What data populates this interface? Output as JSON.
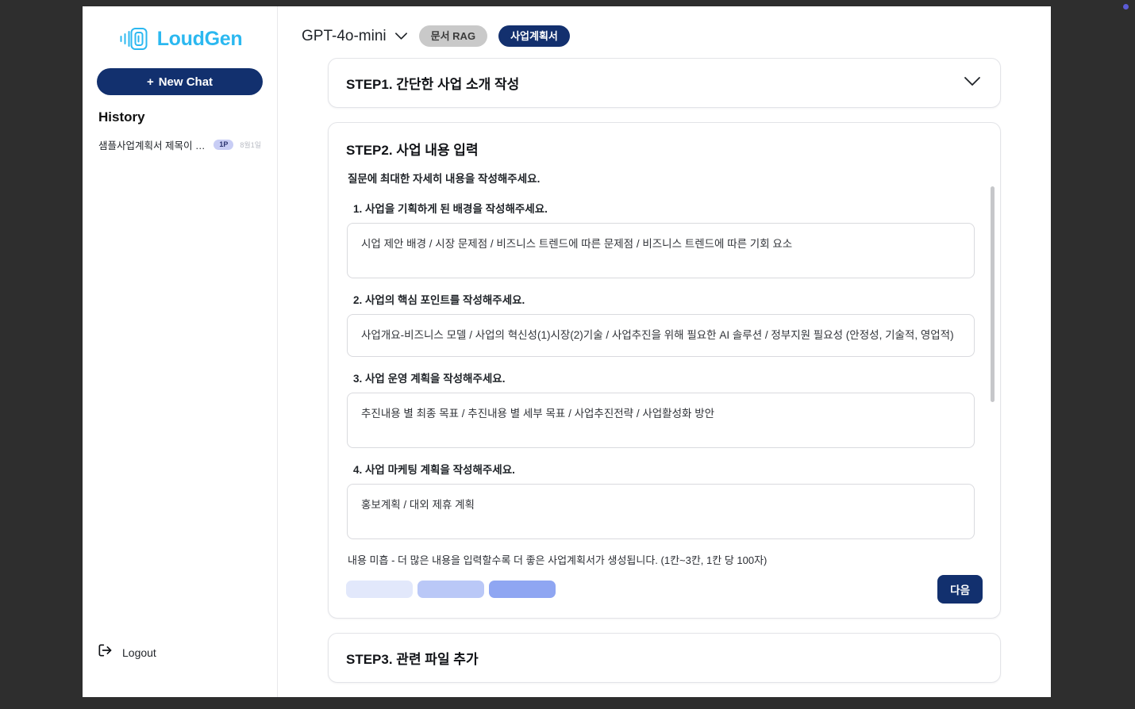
{
  "brand": {
    "name": "LoudGen",
    "icon": "soundwave-logo-icon",
    "color": "#2bb8f0"
  },
  "sidebar": {
    "new_chat_label": "New Chat",
    "new_chat_plus": "+",
    "history_heading": "History",
    "history_items": [
      {
        "label": "샘플사업계획서 제목이 나타...",
        "badge": "1P",
        "date": "8월1일"
      }
    ],
    "logout_label": "Logout",
    "logout_icon": "logout-icon"
  },
  "topbar": {
    "model": "GPT-4o-mini",
    "chevron": "chevron-down-icon",
    "tabs": [
      {
        "label": "문서 RAG",
        "active": false
      },
      {
        "label": "사업계획서",
        "active": true
      }
    ]
  },
  "steps": {
    "step1": {
      "title": "STEP1. 간단한 사업 소개 작성",
      "chevron": "chevron-down-icon"
    },
    "step2": {
      "title": "STEP2. 사업 내용 입력",
      "subtitle": "질문에 최대한 자세히  내용을 작성해주세요.",
      "questions": [
        {
          "label": "1. 사업을 기획하게 된 배경을 작성해주세요.",
          "value": "시업 제안 배경 / 시장 문제점 / 비즈니스 트렌드에 따른 문제점 / 비즈니스 트렌드에 따른 기회 요소"
        },
        {
          "label": "2. 사업의 핵심 포인트를 작성해주세요.",
          "value": "사업개요-비즈니스 모델 / 사업의 혁신성(1)시장(2)기술 / 사업추진을 위해 필요한 AI 솔루션 / 정부지원 필요성 (안정성, 기술적, 영업적)"
        },
        {
          "label": "3. 사업 운영 계획을 작성해주세요.",
          "value": "추진내용 별 최종 목표 / 추진내용 별 세부 목표 / 사업추진전략 / 사업활성화 방안"
        },
        {
          "label": "4. 사업 마케팅 계획을 작성해주세요.",
          "value": "홍보계획 / 대외 제휴 계획"
        }
      ],
      "hint": "내용 미흡 - 더 많은 내용을 입력할수록 더 좋은 사업계획서가 생성됩니다. (1칸~3칸, 1칸 당 100자)",
      "progress_bars": [
        "#e2e8fb",
        "#bac8f7",
        "#8fa6f2"
      ],
      "next_label": "다음"
    },
    "step3": {
      "title": "STEP3. 관련 파일 추가"
    }
  },
  "colors": {
    "brand_blue": "#2bb8f0",
    "navy": "#12306e",
    "pill_gray": "#c9c9c9",
    "corner_dot": "#5b5bd6"
  }
}
